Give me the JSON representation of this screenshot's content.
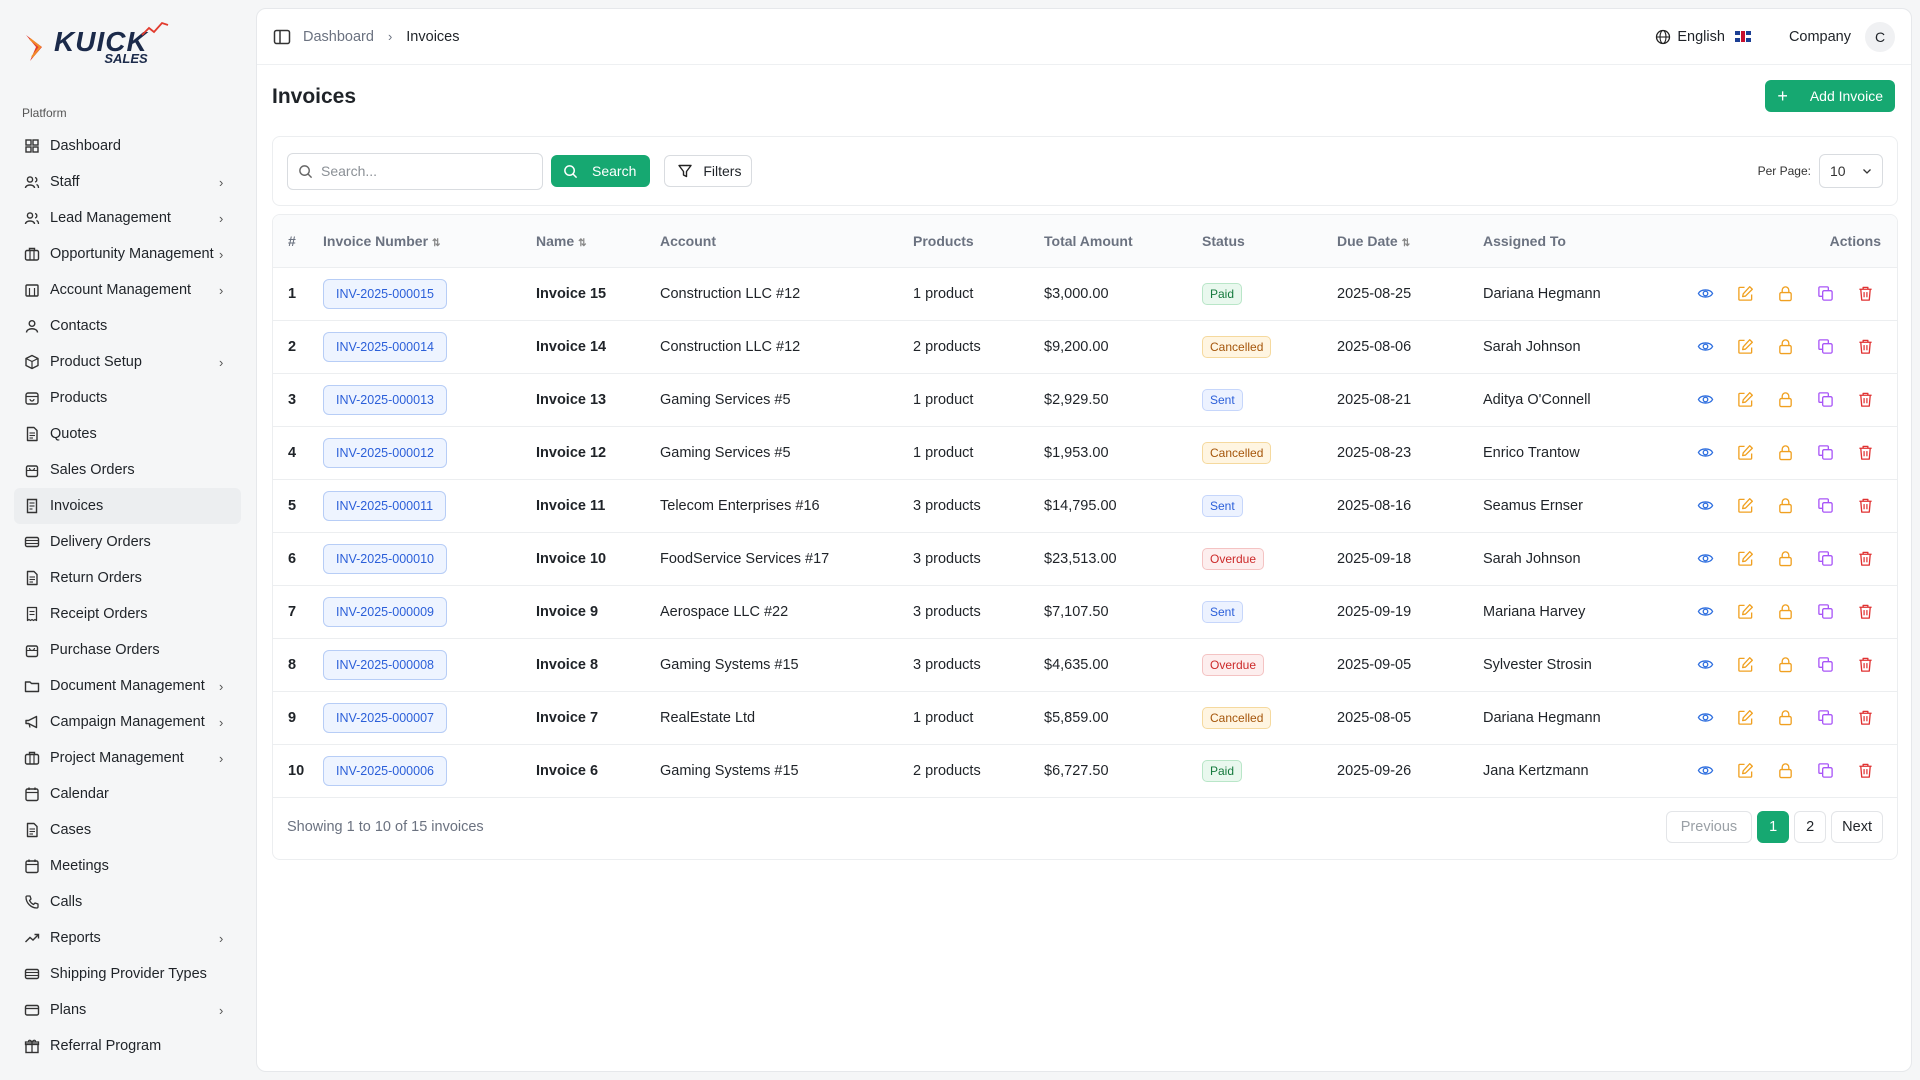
{
  "brand": {
    "logo_top": "KUICK",
    "logo_bottom": "SALES"
  },
  "sidebar": {
    "section": "Platform",
    "items": [
      {
        "label": "Dashboard",
        "icon": "dashboard-grid-icon",
        "has_children": false,
        "active": false
      },
      {
        "label": "Staff",
        "icon": "users-icon",
        "has_children": true,
        "active": false
      },
      {
        "label": "Lead Management",
        "icon": "users-icon",
        "has_children": true,
        "active": false
      },
      {
        "label": "Opportunity Management",
        "icon": "briefcase-icon",
        "has_children": true,
        "active": false
      },
      {
        "label": "Account Management",
        "icon": "building-icon",
        "has_children": true,
        "active": false
      },
      {
        "label": "Contacts",
        "icon": "user-icon",
        "has_children": false,
        "active": false
      },
      {
        "label": "Product Setup",
        "icon": "box-icon",
        "has_children": true,
        "active": false
      },
      {
        "label": "Products",
        "icon": "package-icon",
        "has_children": false,
        "active": false
      },
      {
        "label": "Quotes",
        "icon": "document-icon",
        "has_children": false,
        "active": false
      },
      {
        "label": "Sales Orders",
        "icon": "shopping-bag-icon",
        "has_children": false,
        "active": false
      },
      {
        "label": "Invoices",
        "icon": "invoice-icon",
        "has_children": false,
        "active": true
      },
      {
        "label": "Delivery Orders",
        "icon": "truck-icon",
        "has_children": false,
        "active": false
      },
      {
        "label": "Return Orders",
        "icon": "document-icon",
        "has_children": false,
        "active": false
      },
      {
        "label": "Receipt Orders",
        "icon": "receipt-icon",
        "has_children": false,
        "active": false
      },
      {
        "label": "Purchase Orders",
        "icon": "shopping-bag-icon",
        "has_children": false,
        "active": false
      },
      {
        "label": "Document Management",
        "icon": "folder-icon",
        "has_children": true,
        "active": false
      },
      {
        "label": "Campaign Management",
        "icon": "megaphone-icon",
        "has_children": true,
        "active": false
      },
      {
        "label": "Project Management",
        "icon": "briefcase-icon",
        "has_children": true,
        "active": false
      },
      {
        "label": "Calendar",
        "icon": "calendar-icon",
        "has_children": false,
        "active": false
      },
      {
        "label": "Cases",
        "icon": "document-icon",
        "has_children": false,
        "active": false
      },
      {
        "label": "Meetings",
        "icon": "calendar-icon",
        "has_children": false,
        "active": false
      },
      {
        "label": "Calls",
        "icon": "phone-icon",
        "has_children": false,
        "active": false
      },
      {
        "label": "Reports",
        "icon": "trending-up-icon",
        "has_children": true,
        "active": false
      },
      {
        "label": "Shipping Provider Types",
        "icon": "truck-icon",
        "has_children": false,
        "active": false
      },
      {
        "label": "Plans",
        "icon": "credit-card-icon",
        "has_children": true,
        "active": false
      },
      {
        "label": "Referral Program",
        "icon": "gift-icon",
        "has_children": false,
        "active": false
      }
    ]
  },
  "topbar": {
    "breadcrumb": [
      "Dashboard",
      "Invoices"
    ],
    "language": "English",
    "company": "Company",
    "avatar_initial": "C"
  },
  "page": {
    "title": "Invoices",
    "add_button": "Add Invoice"
  },
  "filters": {
    "search_placeholder": "Search...",
    "search_button": "Search",
    "filters_button": "Filters",
    "per_page_label": "Per Page:",
    "per_page_value": "10"
  },
  "table": {
    "columns": [
      "#",
      "Invoice Number",
      "Name",
      "Account",
      "Products",
      "Total Amount",
      "Status",
      "Due Date",
      "Assigned To",
      "Actions"
    ],
    "rows": [
      {
        "num": "1",
        "invoice": "INV-2025-000015",
        "name": "Invoice 15",
        "account": "Construction LLC #12",
        "products": "1 product",
        "total": "$3,000.00",
        "status": "Paid",
        "status_type": "paid",
        "due": "2025-08-25",
        "assigned": "Dariana Hegmann"
      },
      {
        "num": "2",
        "invoice": "INV-2025-000014",
        "name": "Invoice 14",
        "account": "Construction LLC #12",
        "products": "2 products",
        "total": "$9,200.00",
        "status": "Cancelled",
        "status_type": "cancelled",
        "due": "2025-08-06",
        "assigned": "Sarah Johnson"
      },
      {
        "num": "3",
        "invoice": "INV-2025-000013",
        "name": "Invoice 13",
        "account": "Gaming Services #5",
        "products": "1 product",
        "total": "$2,929.50",
        "status": "Sent",
        "status_type": "sent",
        "due": "2025-08-21",
        "assigned": "Aditya O'Connell"
      },
      {
        "num": "4",
        "invoice": "INV-2025-000012",
        "name": "Invoice 12",
        "account": "Gaming Services #5",
        "products": "1 product",
        "total": "$1,953.00",
        "status": "Cancelled",
        "status_type": "cancelled",
        "due": "2025-08-23",
        "assigned": "Enrico Trantow"
      },
      {
        "num": "5",
        "invoice": "INV-2025-000011",
        "name": "Invoice 11",
        "account": "Telecom Enterprises #16",
        "products": "3 products",
        "total": "$14,795.00",
        "status": "Sent",
        "status_type": "sent",
        "due": "2025-08-16",
        "assigned": "Seamus Ernser"
      },
      {
        "num": "6",
        "invoice": "INV-2025-000010",
        "name": "Invoice 10",
        "account": "FoodService Services #17",
        "products": "3 products",
        "total": "$23,513.00",
        "status": "Overdue",
        "status_type": "overdue",
        "due": "2025-09-18",
        "assigned": "Sarah Johnson"
      },
      {
        "num": "7",
        "invoice": "INV-2025-000009",
        "name": "Invoice 9",
        "account": "Aerospace LLC #22",
        "products": "3 products",
        "total": "$7,107.50",
        "status": "Sent",
        "status_type": "sent",
        "due": "2025-09-19",
        "assigned": "Mariana Harvey"
      },
      {
        "num": "8",
        "invoice": "INV-2025-000008",
        "name": "Invoice 8",
        "account": "Gaming Systems #15",
        "products": "3 products",
        "total": "$4,635.00",
        "status": "Overdue",
        "status_type": "overdue",
        "due": "2025-09-05",
        "assigned": "Sylvester Strosin"
      },
      {
        "num": "9",
        "invoice": "INV-2025-000007",
        "name": "Invoice 7",
        "account": "RealEstate Ltd",
        "products": "1 product",
        "total": "$5,859.00",
        "status": "Cancelled",
        "status_type": "cancelled",
        "due": "2025-08-05",
        "assigned": "Dariana Hegmann"
      },
      {
        "num": "10",
        "invoice": "INV-2025-000006",
        "name": "Invoice 6",
        "account": "Gaming Systems #15",
        "products": "2 products",
        "total": "$6,727.50",
        "status": "Paid",
        "status_type": "paid",
        "due": "2025-09-26",
        "assigned": "Jana Kertzmann"
      }
    ]
  },
  "pagination": {
    "showing_text": "Showing 1 to 10 of 15 invoices",
    "previous": "Previous",
    "pages": [
      "1",
      "2"
    ],
    "current_page": "1",
    "next": "Next"
  },
  "colors": {
    "primary": "#16a871",
    "view_icon": "#2f6fdf",
    "edit_icon": "#f0a020",
    "lock_icon": "#f0a020",
    "copy_icon": "#a855f7",
    "delete_icon": "#e03131"
  }
}
